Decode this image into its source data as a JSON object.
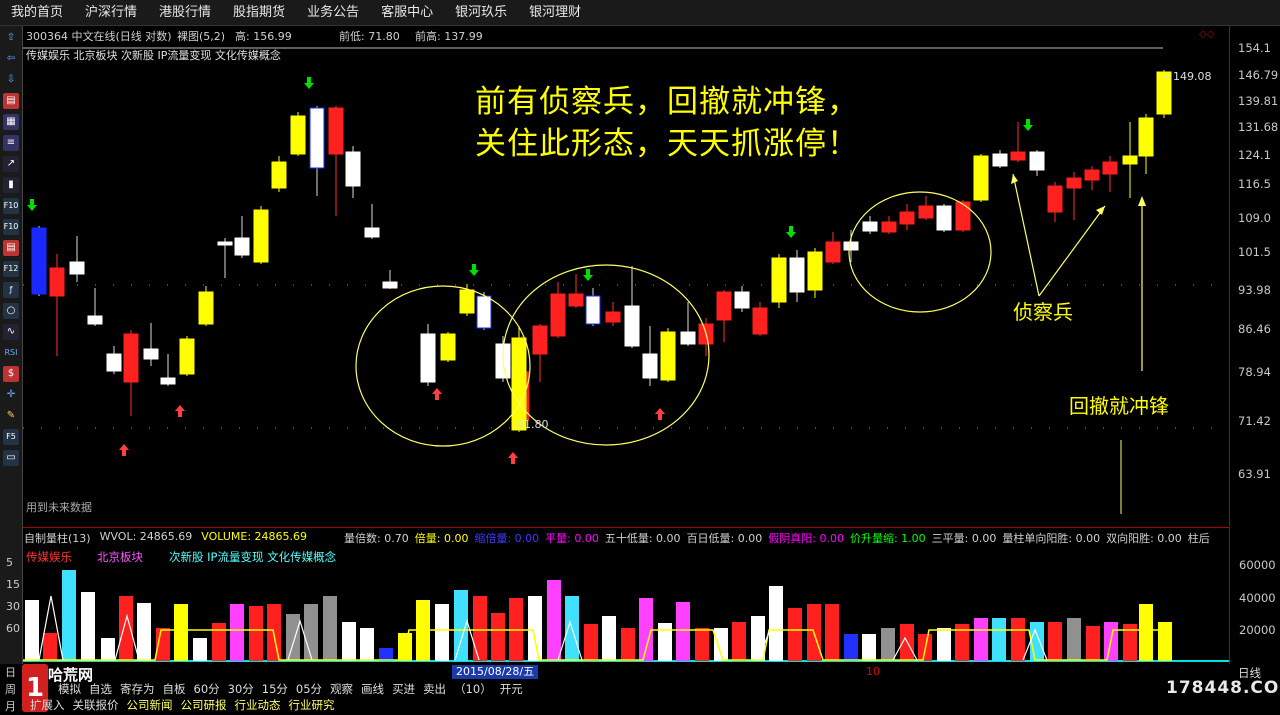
{
  "menu": [
    "我的首页",
    "沪深行情",
    "港股行情",
    "股指期货",
    "业务公告",
    "客服中心",
    "银河玖乐",
    "银河理财"
  ],
  "chart_header": {
    "code_name": "300364 中文在线(日线 对数)",
    "mode": "裸图(5,2)",
    "high_label": "高: 156.99",
    "prev_low": "前低: 71.80",
    "prev_high": "前高: 137.99"
  },
  "concepts_line": "传媒娱乐 北京板块 次新股 IP流量变现 文化传媒概念",
  "annotations": {
    "line1": "前有侦察兵，回撤就冲锋，",
    "line2": "关住此形态，天天抓涨停！",
    "scout": "侦察兵",
    "charge": "回撤就冲锋",
    "price_low": "71.80",
    "price_high": "149.08",
    "future_data": "用到未来数据"
  },
  "y_axis": [
    "154.1",
    "146.79",
    "139.81",
    "131.68",
    "124.1",
    "116.5",
    "109.0",
    "101.5",
    "93.98",
    "86.46",
    "78.94",
    "71.42",
    "63.91"
  ],
  "vol_header": {
    "title": "自制量柱(13)",
    "wvol": "WVOL: 24865.69",
    "volume": "VOLUME: 24865.69",
    "items": [
      {
        "label": "量倍数: 0.70",
        "color": "#d0d0d0"
      },
      {
        "label": "倍量: 0.00",
        "color": "#ffff00"
      },
      {
        "label": "缩倍量: 0.00",
        "color": "#3a3aff"
      },
      {
        "label": "平量: 0.00",
        "color": "#ff00ff"
      },
      {
        "label": "五十低量: 0.00",
        "color": "#d0d0d0"
      },
      {
        "label": "百日低量: 0.00",
        "color": "#d0d0d0"
      },
      {
        "label": "假阴真阳: 0.00",
        "color": "#ff00ff"
      },
      {
        "label": "价升量缩: 1.00",
        "color": "#00ff00"
      },
      {
        "label": "三平量: 0.00",
        "color": "#d0d0d0"
      },
      {
        "label": "量柱单向阳胜: 0.00",
        "color": "#d0d0d0"
      },
      {
        "label": "双向阳胜: 0.00",
        "color": "#d0d0d0"
      },
      {
        "label": "柱后",
        "color": "#d0d0d0"
      }
    ]
  },
  "vol_concepts": {
    "c1": "传媒娱乐",
    "c2": "北京板块",
    "c3": "次新股 IP流量变现 文化传媒概念"
  },
  "vol_axis": [
    "60000",
    "40000",
    "20000"
  ],
  "left_numbers": [
    "5",
    "15",
    "30",
    "60"
  ],
  "period_labels": [
    "日",
    "周",
    "月"
  ],
  "date_label": "2015/08/28/五",
  "x_tick": "10",
  "period_right": "日线",
  "bottom_tabs": [
    "模拟",
    "自选",
    "寄存为",
    "自板",
    "60分",
    "30分",
    "15分",
    "05分",
    "观察",
    "画线",
    "买进",
    "卖出",
    "（10）",
    "开元"
  ],
  "bottom_tabs2": [
    "扩展入",
    "关联报价",
    "公司新闻",
    "公司研报",
    "行业动态",
    "行业研究"
  ],
  "watermark": "178448.COM",
  "logo_text": "哈荒网"
}
